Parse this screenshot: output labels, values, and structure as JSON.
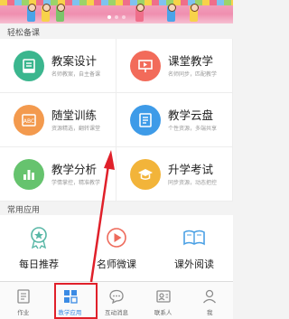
{
  "sections": {
    "easy_prep": "轻松备课",
    "common_apps": "常用应用"
  },
  "cards": [
    {
      "title": "教案设计",
      "subtitle": "名师教案，自主备课",
      "icon": "book-icon",
      "color": "#3bb68e"
    },
    {
      "title": "课堂教学",
      "subtitle": "名师同步，匹配教学",
      "icon": "presentation-icon",
      "color": "#f26b5a"
    },
    {
      "title": "随堂训练",
      "subtitle": "资源精选，翻转课堂",
      "icon": "abc-icon",
      "color": "#f39a4e"
    },
    {
      "title": "教学云盘",
      "subtitle": "个性资源，多端共享",
      "icon": "cloud-disk-icon",
      "color": "#3e9be8"
    },
    {
      "title": "教学分析",
      "subtitle": "学情掌控，精准教学",
      "icon": "bar-chart-icon",
      "color": "#66c36e"
    },
    {
      "title": "升学考试",
      "subtitle": "同步资源，动态把控",
      "icon": "graduation-cap-icon",
      "color": "#f2b43a"
    }
  ],
  "apps": [
    {
      "label": "每日推荐",
      "icon": "badge-icon"
    },
    {
      "label": "名师微课",
      "icon": "play-icon"
    },
    {
      "label": "课外阅读",
      "icon": "open-book-icon"
    }
  ],
  "tabs": [
    {
      "label": "作业",
      "icon": "homework-icon",
      "active": false
    },
    {
      "label": "教学应用",
      "icon": "apps-grid-icon",
      "active": true
    },
    {
      "label": "互动消息",
      "icon": "chat-icon",
      "active": false
    },
    {
      "label": "联系人",
      "icon": "contacts-icon",
      "active": false
    },
    {
      "label": "我",
      "icon": "user-icon",
      "active": false
    }
  ],
  "colors": {
    "accent": "#3b8be4",
    "annotation": "#e0202a"
  }
}
